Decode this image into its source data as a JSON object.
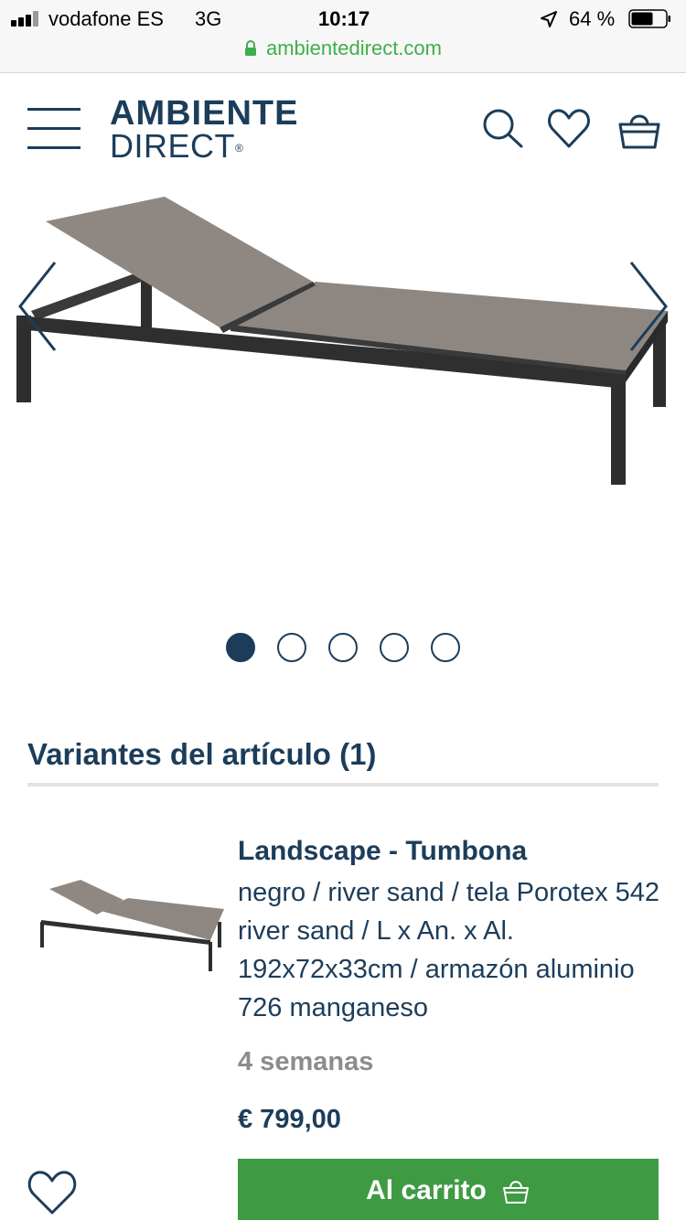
{
  "status_bar": {
    "carrier": "vodafone ES",
    "network": "3G",
    "time": "10:17",
    "battery": "64 %",
    "battery_level": 0.64
  },
  "browser": {
    "url": "ambientedirect.com"
  },
  "header": {
    "logo_line1": "AMBIENTE",
    "logo_line2": "DIRECT",
    "logo_mark": "®",
    "icons": [
      "menu-icon",
      "search-icon",
      "heart-icon",
      "basket-icon"
    ]
  },
  "gallery": {
    "slide_count": 5,
    "active_slide": 1,
    "image": "sun lounger (landscape) product photo"
  },
  "variants": {
    "title": "Variantes del artículo (1)",
    "items": [
      {
        "name": "Landscape - Tumbona",
        "description": "negro / river sand / tela Porotex 542 river sand / L x An. x Al. 192x72x33cm / armazón aluminio 726 manganeso",
        "delivery": "4 semanas",
        "price": "€ 799,00",
        "cart_label": "Al carrito"
      }
    ]
  },
  "colors": {
    "brand_navy": "#1c3d5a",
    "cart_green": "#3f9a44",
    "url_green": "#3fae4a",
    "muted_gray": "#8c8c8c"
  }
}
